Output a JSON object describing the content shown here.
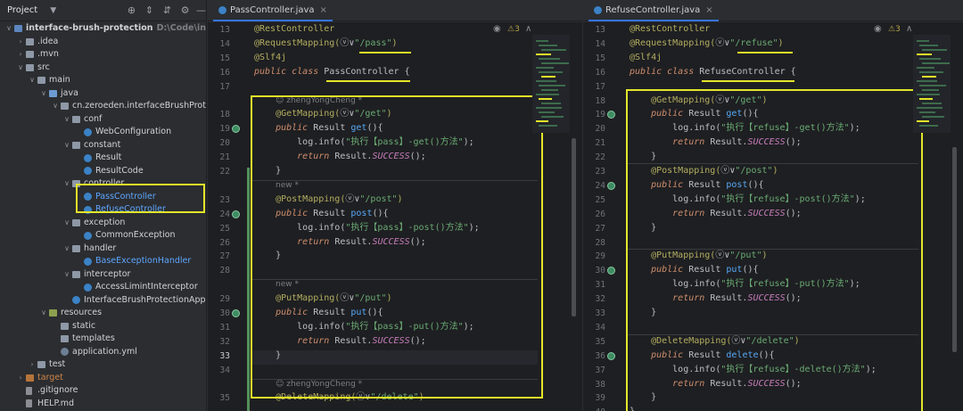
{
  "project_panel": {
    "title": "Project",
    "tree": [
      {
        "label": "interface-brush-protection",
        "hint": "D:\\Code\\interface-",
        "icon": "folder-module",
        "arrow": "down",
        "level": 0,
        "bold": true
      },
      {
        "label": ".idea",
        "icon": "folder",
        "arrow": "right",
        "level": 1
      },
      {
        "label": ".mvn",
        "icon": "folder",
        "arrow": "right",
        "level": 1
      },
      {
        "label": "src",
        "icon": "folder",
        "arrow": "down",
        "level": 1
      },
      {
        "label": "main",
        "icon": "folder",
        "arrow": "down",
        "level": 2
      },
      {
        "label": "java",
        "icon": "folder-source",
        "arrow": "down",
        "level": 3
      },
      {
        "label": "cn.zeroeden.interfaceBrushProtect",
        "icon": "folder",
        "arrow": "down",
        "level": 4
      },
      {
        "label": "conf",
        "icon": "folder",
        "arrow": "down",
        "level": 5
      },
      {
        "label": "WebConfiguration",
        "icon": "class",
        "level": 6
      },
      {
        "label": "constant",
        "icon": "folder",
        "arrow": "down",
        "level": 5
      },
      {
        "label": "Result",
        "icon": "class",
        "level": 6
      },
      {
        "label": "ResultCode",
        "icon": "class",
        "level": 6
      },
      {
        "label": "controller",
        "icon": "folder",
        "arrow": "down",
        "level": 5
      },
      {
        "label": "PassController",
        "icon": "class",
        "level": 6,
        "style": "blue"
      },
      {
        "label": "RefuseController",
        "icon": "class",
        "level": 6,
        "style": "blue"
      },
      {
        "label": "exception",
        "icon": "folder",
        "arrow": "down",
        "level": 5
      },
      {
        "label": "CommonException",
        "icon": "class",
        "level": 6
      },
      {
        "label": "handler",
        "icon": "folder",
        "arrow": "down",
        "level": 5
      },
      {
        "label": "BaseExceptionHandler",
        "icon": "class",
        "level": 6,
        "style": "blue"
      },
      {
        "label": "interceptor",
        "icon": "folder",
        "arrow": "down",
        "level": 5
      },
      {
        "label": "AccessLimintInterceptor",
        "icon": "class",
        "level": 6
      },
      {
        "label": "InterfaceBrushProtectionApplica",
        "icon": "class",
        "level": 5
      },
      {
        "label": "resources",
        "icon": "folder-resources",
        "arrow": "down",
        "level": 3
      },
      {
        "label": "static",
        "icon": "folder",
        "level": 4
      },
      {
        "label": "templates",
        "icon": "folder",
        "level": 4
      },
      {
        "label": "application.yml",
        "icon": "yml",
        "level": 4
      },
      {
        "label": "test",
        "icon": "folder",
        "arrow": "right",
        "level": 2
      },
      {
        "label": "target",
        "icon": "folder-target",
        "arrow": "right",
        "level": 1,
        "style": "orange"
      },
      {
        "label": ".gitignore",
        "icon": "file",
        "level": 1
      },
      {
        "label": "HELP.md",
        "icon": "file",
        "level": 1
      }
    ]
  },
  "left_editor": {
    "tab": "PassController.java",
    "warnings": "3",
    "lines": [
      {
        "n": "13",
        "code": [
          {
            "t": "@RestController",
            "c": "ann"
          }
        ]
      },
      {
        "n": "14",
        "code": [
          {
            "t": "@RequestMapping(",
            "c": "ann"
          },
          {
            "t": "ⓥ∨",
            "c": ""
          },
          {
            "t": "\"/pass\"",
            "c": "str"
          },
          {
            "t": ")",
            "c": "ann"
          }
        ]
      },
      {
        "n": "15",
        "code": [
          {
            "t": "@Slf4j",
            "c": "ann"
          }
        ]
      },
      {
        "n": "16",
        "code": [
          {
            "t": "public class ",
            "c": "kw"
          },
          {
            "t": "PassController",
            "c": ""
          },
          {
            "t": " {",
            "c": ""
          }
        ]
      },
      {
        "n": "17",
        "code": []
      },
      {
        "n": "",
        "hint": "zhengYongCheng *"
      },
      {
        "n": "18",
        "code": [
          {
            "t": "    @GetMapping(",
            "c": "ann"
          },
          {
            "t": "ⓥ∨",
            "c": ""
          },
          {
            "t": "\"/get\"",
            "c": "str"
          },
          {
            "t": ")",
            "c": "ann"
          }
        ]
      },
      {
        "n": "19",
        "code": [
          {
            "t": "    public ",
            "c": "kw"
          },
          {
            "t": "Result ",
            "c": ""
          },
          {
            "t": "get",
            "c": "fn"
          },
          {
            "t": "(){",
            "c": ""
          }
        ]
      },
      {
        "n": "20",
        "code": [
          {
            "t": "        log.info(",
            "c": ""
          },
          {
            "t": "\"执行【pass】-get()方法\"",
            "c": "str"
          },
          {
            "t": ");",
            "c": ""
          }
        ]
      },
      {
        "n": "21",
        "code": [
          {
            "t": "        return ",
            "c": "kw"
          },
          {
            "t": "Result.",
            "c": ""
          },
          {
            "t": "SUCCESS",
            "c": "fld"
          },
          {
            "t": "();",
            "c": ""
          }
        ]
      },
      {
        "n": "22",
        "code": [
          {
            "t": "    }",
            "c": ""
          }
        ]
      },
      {
        "n": "",
        "hint": "new *"
      },
      {
        "n": "23",
        "code": [
          {
            "t": "    @PostMapping(",
            "c": "ann"
          },
          {
            "t": "ⓥ∨",
            "c": ""
          },
          {
            "t": "\"/post\"",
            "c": "str"
          },
          {
            "t": ")",
            "c": "ann"
          }
        ]
      },
      {
        "n": "24",
        "code": [
          {
            "t": "    public ",
            "c": "kw"
          },
          {
            "t": "Result ",
            "c": ""
          },
          {
            "t": "post",
            "c": "fn"
          },
          {
            "t": "(){",
            "c": ""
          }
        ]
      },
      {
        "n": "25",
        "code": [
          {
            "t": "        log.info(",
            "c": ""
          },
          {
            "t": "\"执行【pass】-post()方法\"",
            "c": "str"
          },
          {
            "t": ");",
            "c": ""
          }
        ]
      },
      {
        "n": "26",
        "code": [
          {
            "t": "        return ",
            "c": "kw"
          },
          {
            "t": "Result.",
            "c": ""
          },
          {
            "t": "SUCCESS",
            "c": "fld"
          },
          {
            "t": "();",
            "c": ""
          }
        ]
      },
      {
        "n": "27",
        "code": [
          {
            "t": "    }",
            "c": ""
          }
        ]
      },
      {
        "n": "28",
        "code": []
      },
      {
        "n": "",
        "hint": "new *"
      },
      {
        "n": "29",
        "code": [
          {
            "t": "    @PutMapping(",
            "c": "ann"
          },
          {
            "t": "ⓥ∨",
            "c": ""
          },
          {
            "t": "\"/put\"",
            "c": "str"
          },
          {
            "t": ")",
            "c": "ann"
          }
        ]
      },
      {
        "n": "30",
        "code": [
          {
            "t": "    public ",
            "c": "kw"
          },
          {
            "t": "Result ",
            "c": ""
          },
          {
            "t": "put",
            "c": "fn"
          },
          {
            "t": "(){",
            "c": ""
          }
        ]
      },
      {
        "n": "31",
        "code": [
          {
            "t": "        log.info(",
            "c": ""
          },
          {
            "t": "\"执行【pass】-put()方法\"",
            "c": "str"
          },
          {
            "t": ");",
            "c": ""
          }
        ]
      },
      {
        "n": "32",
        "code": [
          {
            "t": "        return ",
            "c": "kw"
          },
          {
            "t": "Result.",
            "c": ""
          },
          {
            "t": "SUCCESS",
            "c": "fld"
          },
          {
            "t": "();",
            "c": ""
          }
        ]
      },
      {
        "n": "33",
        "code": [
          {
            "t": "    }",
            "c": ""
          }
        ]
      },
      {
        "n": "34",
        "code": []
      },
      {
        "n": "",
        "hint": "zhengYongCheng *"
      },
      {
        "n": "35",
        "code": [
          {
            "t": "    @DeleteMapping(",
            "c": "ann"
          },
          {
            "t": "ⓥ∨",
            "c": ""
          },
          {
            "t": "\"/delete\"",
            "c": "str"
          },
          {
            "t": ")",
            "c": "ann"
          }
        ]
      }
    ]
  },
  "right_editor": {
    "tab": "RefuseController.java",
    "warnings": "3",
    "lines": [
      {
        "n": "13",
        "code": [
          {
            "t": "@RestController",
            "c": "ann"
          }
        ]
      },
      {
        "n": "14",
        "code": [
          {
            "t": "@RequestMapping(",
            "c": "ann"
          },
          {
            "t": "ⓥ∨",
            "c": ""
          },
          {
            "t": "\"/refuse\"",
            "c": "str"
          },
          {
            "t": ")",
            "c": "ann"
          }
        ]
      },
      {
        "n": "15",
        "code": [
          {
            "t": "@Slf4j",
            "c": "ann"
          }
        ]
      },
      {
        "n": "16",
        "code": [
          {
            "t": "public class ",
            "c": "kw"
          },
          {
            "t": "RefuseController",
            "c": ""
          },
          {
            "t": " {",
            "c": ""
          }
        ]
      },
      {
        "n": "17",
        "code": []
      },
      {
        "n": "18",
        "code": [
          {
            "t": "    @GetMapping(",
            "c": "ann"
          },
          {
            "t": "ⓥ∨",
            "c": ""
          },
          {
            "t": "\"/get\"",
            "c": "str"
          },
          {
            "t": ")",
            "c": "ann"
          }
        ]
      },
      {
        "n": "19",
        "code": [
          {
            "t": "    public ",
            "c": "kw"
          },
          {
            "t": "Result ",
            "c": ""
          },
          {
            "t": "get",
            "c": "fn"
          },
          {
            "t": "(){",
            "c": ""
          }
        ]
      },
      {
        "n": "20",
        "code": [
          {
            "t": "        log.info(",
            "c": ""
          },
          {
            "t": "\"执行【refuse】-get()方法\"",
            "c": "str"
          },
          {
            "t": ");",
            "c": ""
          }
        ]
      },
      {
        "n": "21",
        "code": [
          {
            "t": "        return ",
            "c": "kw"
          },
          {
            "t": "Result.",
            "c": ""
          },
          {
            "t": "SUCCESS",
            "c": "fld"
          },
          {
            "t": "();",
            "c": ""
          }
        ]
      },
      {
        "n": "22",
        "code": [
          {
            "t": "    }",
            "c": ""
          }
        ]
      },
      {
        "n": "23",
        "code": [
          {
            "t": "    @PostMapping(",
            "c": "ann"
          },
          {
            "t": "ⓥ∨",
            "c": ""
          },
          {
            "t": "\"/post\"",
            "c": "str"
          },
          {
            "t": ")",
            "c": "ann"
          }
        ]
      },
      {
        "n": "24",
        "code": [
          {
            "t": "    public ",
            "c": "kw"
          },
          {
            "t": "Result ",
            "c": ""
          },
          {
            "t": "post",
            "c": "fn"
          },
          {
            "t": "(){",
            "c": ""
          }
        ]
      },
      {
        "n": "25",
        "code": [
          {
            "t": "        log.info(",
            "c": ""
          },
          {
            "t": "\"执行【refuse】-post()方法\"",
            "c": "str"
          },
          {
            "t": ");",
            "c": ""
          }
        ]
      },
      {
        "n": "26",
        "code": [
          {
            "t": "        return ",
            "c": "kw"
          },
          {
            "t": "Result.",
            "c": ""
          },
          {
            "t": "SUCCESS",
            "c": "fld"
          },
          {
            "t": "();",
            "c": ""
          }
        ]
      },
      {
        "n": "27",
        "code": [
          {
            "t": "    }",
            "c": ""
          }
        ]
      },
      {
        "n": "28",
        "code": []
      },
      {
        "n": "29",
        "code": [
          {
            "t": "    @PutMapping(",
            "c": "ann"
          },
          {
            "t": "ⓥ∨",
            "c": ""
          },
          {
            "t": "\"/put\"",
            "c": "str"
          },
          {
            "t": ")",
            "c": "ann"
          }
        ]
      },
      {
        "n": "30",
        "code": [
          {
            "t": "    public ",
            "c": "kw"
          },
          {
            "t": "Result ",
            "c": ""
          },
          {
            "t": "put",
            "c": "fn"
          },
          {
            "t": "(){",
            "c": ""
          }
        ]
      },
      {
        "n": "31",
        "code": [
          {
            "t": "        log.info(",
            "c": ""
          },
          {
            "t": "\"执行【refuse】-put()方法\"",
            "c": "str"
          },
          {
            "t": ");",
            "c": ""
          }
        ]
      },
      {
        "n": "32",
        "code": [
          {
            "t": "        return ",
            "c": "kw"
          },
          {
            "t": "Result.",
            "c": ""
          },
          {
            "t": "SUCCESS",
            "c": "fld"
          },
          {
            "t": "();",
            "c": ""
          }
        ]
      },
      {
        "n": "33",
        "code": [
          {
            "t": "    }",
            "c": ""
          }
        ]
      },
      {
        "n": "34",
        "code": []
      },
      {
        "n": "35",
        "code": [
          {
            "t": "    @DeleteMapping(",
            "c": "ann"
          },
          {
            "t": "ⓥ∨",
            "c": ""
          },
          {
            "t": "\"/delete\"",
            "c": "str"
          },
          {
            "t": ")",
            "c": "ann"
          }
        ]
      },
      {
        "n": "36",
        "code": [
          {
            "t": "    public ",
            "c": "kw"
          },
          {
            "t": "Result ",
            "c": ""
          },
          {
            "t": "delete",
            "c": "fn"
          },
          {
            "t": "(){",
            "c": ""
          }
        ]
      },
      {
        "n": "37",
        "code": [
          {
            "t": "        log.info(",
            "c": ""
          },
          {
            "t": "\"执行【refuse】-delete()方法\"",
            "c": "str"
          },
          {
            "t": ");",
            "c": ""
          }
        ]
      },
      {
        "n": "38",
        "code": [
          {
            "t": "        return ",
            "c": "kw"
          },
          {
            "t": "Result.",
            "c": ""
          },
          {
            "t": "SUCCESS",
            "c": "fld"
          },
          {
            "t": "();",
            "c": ""
          }
        ]
      },
      {
        "n": "39",
        "code": [
          {
            "t": "    }",
            "c": ""
          }
        ]
      },
      {
        "n": "40",
        "code": [
          {
            "t": "}",
            "c": ""
          }
        ]
      }
    ]
  },
  "colors": {
    "highlight": "#e3e629",
    "accent": "#3574f0",
    "vcs_added": "#549159"
  }
}
